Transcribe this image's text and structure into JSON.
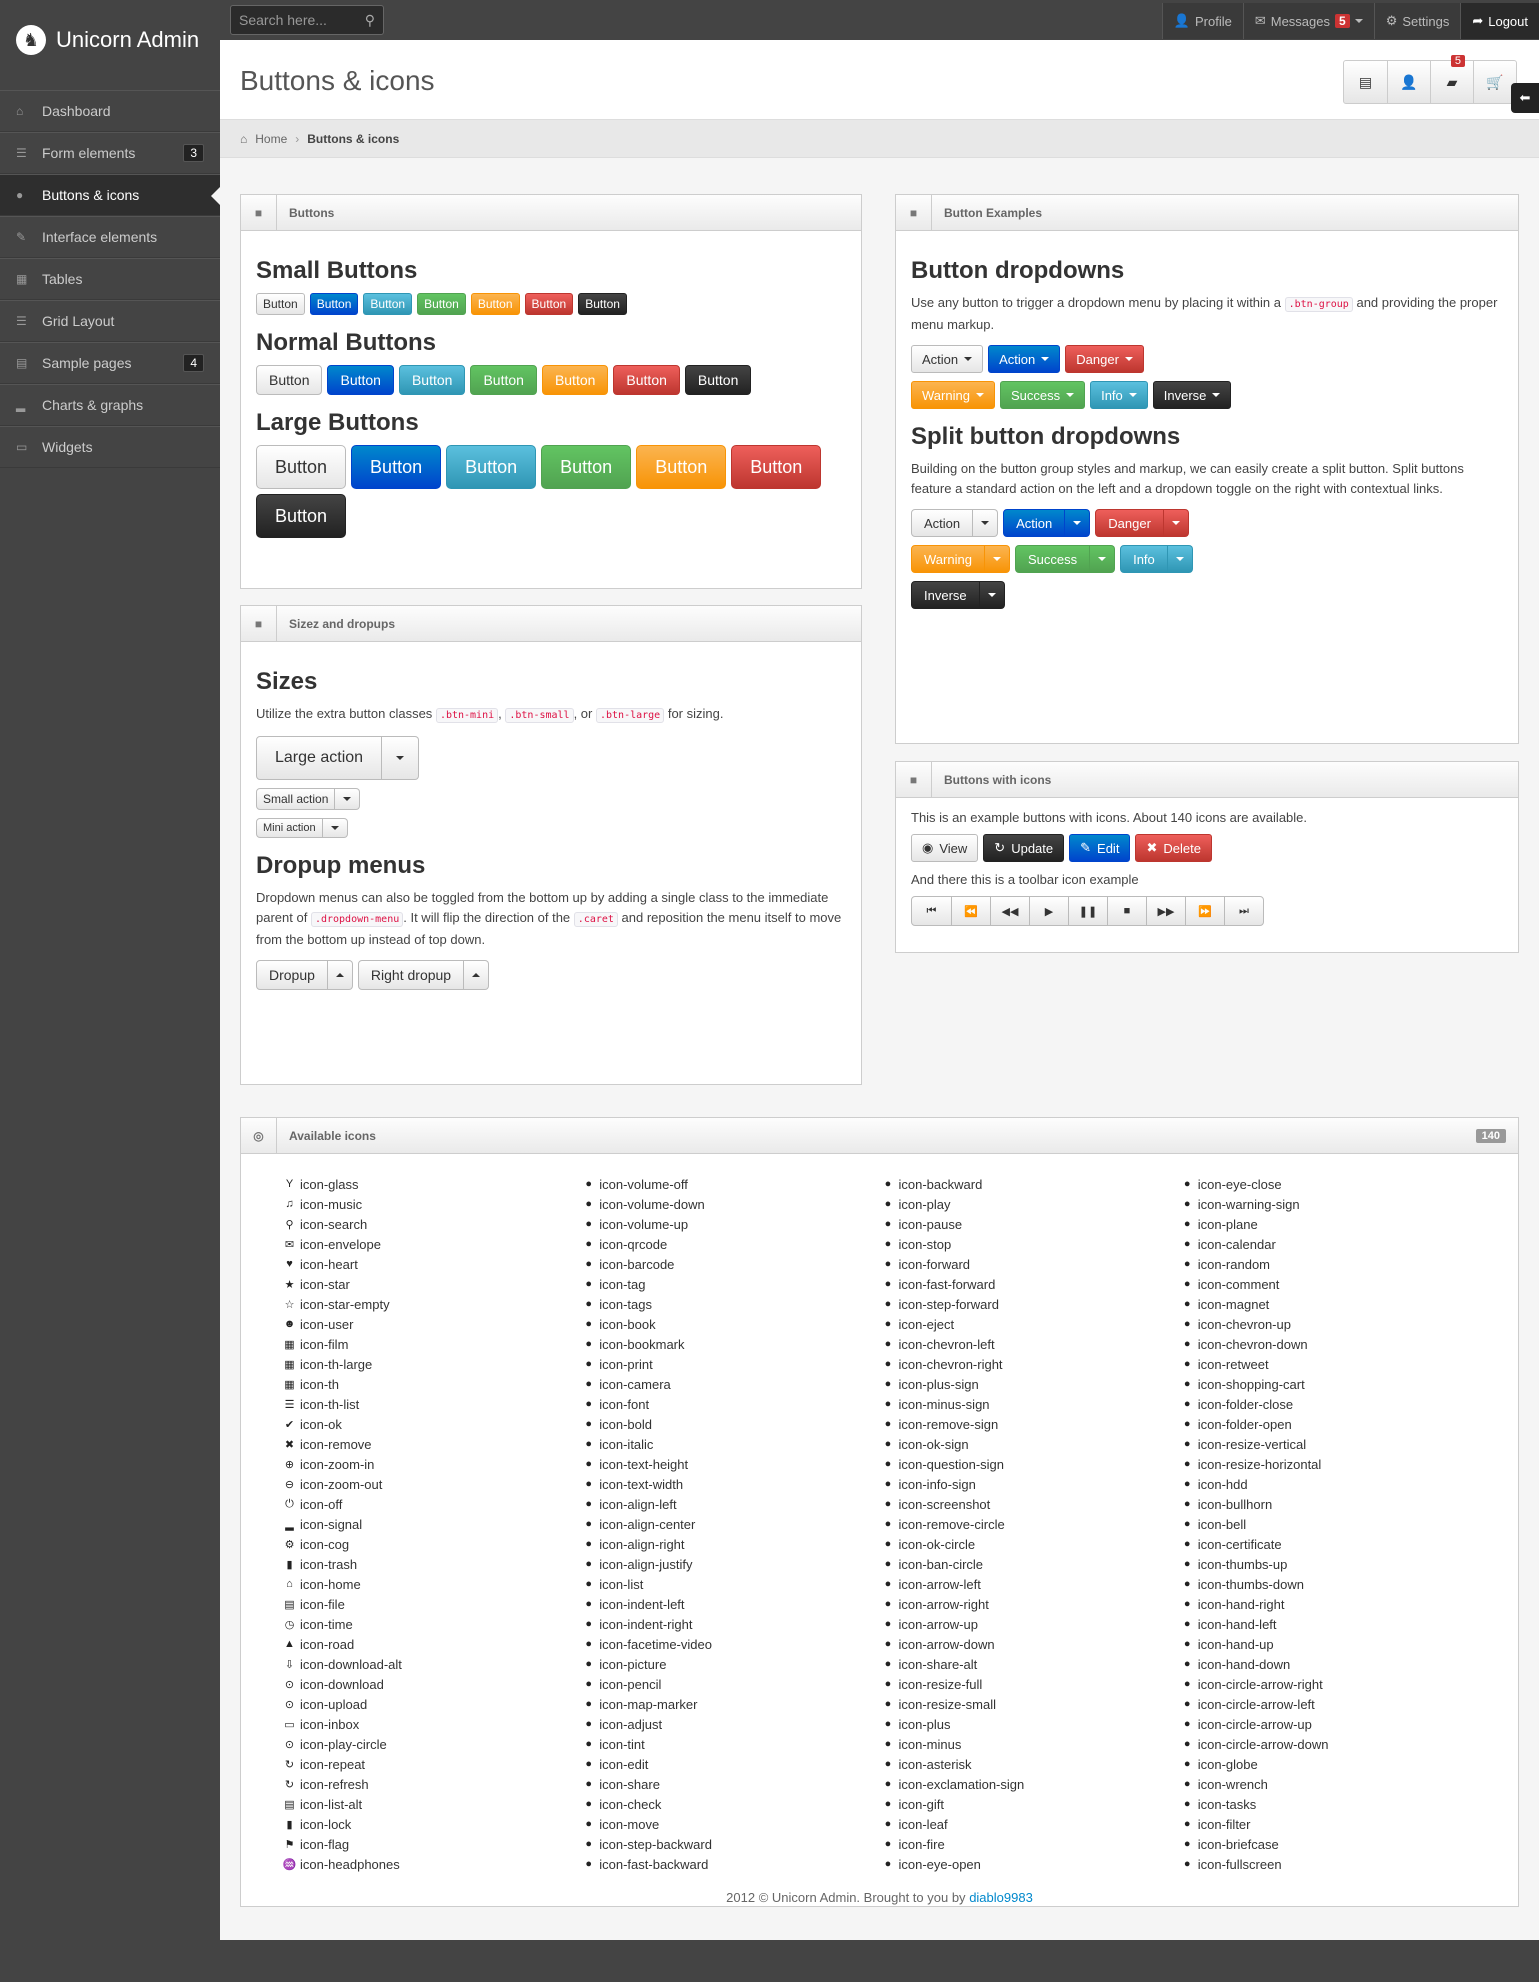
{
  "app": {
    "brand": "Unicorn Admin"
  },
  "search": {
    "placeholder": "Search here..."
  },
  "topnav": {
    "profile": "Profile",
    "messages": "Messages",
    "messages_count": "5",
    "settings": "Settings",
    "logout": "Logout"
  },
  "sidebar": {
    "items": [
      {
        "label": "Dashboard",
        "count": ""
      },
      {
        "label": "Form elements",
        "count": "3"
      },
      {
        "label": "Buttons & icons",
        "count": ""
      },
      {
        "label": "Interface elements",
        "count": ""
      },
      {
        "label": "Tables",
        "count": ""
      },
      {
        "label": "Grid Layout",
        "count": ""
      },
      {
        "label": "Sample pages",
        "count": "4"
      },
      {
        "label": "Charts & graphs",
        "count": ""
      },
      {
        "label": "Widgets",
        "count": ""
      }
    ]
  },
  "page": {
    "title": "Buttons & icons",
    "cart_badge": "5"
  },
  "breadcrumb": {
    "home": "Home",
    "current": "Buttons & icons"
  },
  "buttons_widget": {
    "title": "Buttons",
    "small_heading": "Small Buttons",
    "normal_heading": "Normal Buttons",
    "large_heading": "Large Buttons",
    "button_label": "Button"
  },
  "sizes_widget": {
    "title": "Sizez and dropups",
    "sizes_heading": "Sizes",
    "sizes_text_1": "Utilize the extra button classes",
    "code_mini": ".btn-mini",
    "code_small": ".btn-small",
    "sizes_text_or": ", or",
    "code_large": ".btn-large",
    "sizes_text_2": "for sizing.",
    "large_action": "Large action",
    "small_action": "Small action",
    "mini_action": "Mini action",
    "dropup_heading": "Dropup menus",
    "dropup_text_1": "Dropdown menus can also be toggled from the bottom up by adding a single class to the immediate parent of",
    "code_dropdown_menu": ".dropdown-menu",
    "dropup_text_2": ". It will flip the direction of the",
    "code_caret": ".caret",
    "dropup_text_3": "and reposition the menu itself to move from the bottom up instead of top down.",
    "dropup": "Dropup",
    "right_dropup": "Right dropup"
  },
  "examples_widget": {
    "title": "Button Examples",
    "dropdowns_heading": "Button dropdowns",
    "dropdowns_text_1": "Use any button to trigger a dropdown menu by placing it within a",
    "code_btn_group": ".btn-group",
    "dropdowns_text_2": "and providing the proper menu markup.",
    "split_heading": "Split button dropdowns",
    "split_text": "Building on the button group styles and markup, we can easily create a split button. Split buttons feature a standard action on the left and a dropdown toggle on the right with contextual links.",
    "labels": {
      "action": "Action",
      "danger": "Danger",
      "warning": "Warning",
      "success": "Success",
      "info": "Info",
      "inverse": "Inverse"
    }
  },
  "icons_widget": {
    "title": "Buttons with icons",
    "text": "This is an example buttons with icons. About 140 icons are available.",
    "view": "View",
    "update": "Update",
    "edit": "Edit",
    "delete": "Delete",
    "toolbar_text": "And there this is a toolbar icon example"
  },
  "available_icons": {
    "title": "Available icons",
    "count": "140",
    "columns": [
      [
        "icon-glass",
        "icon-music",
        "icon-search",
        "icon-envelope",
        "icon-heart",
        "icon-star",
        "icon-star-empty",
        "icon-user",
        "icon-film",
        "icon-th-large",
        "icon-th",
        "icon-th-list",
        "icon-ok",
        "icon-remove",
        "icon-zoom-in",
        "icon-zoom-out",
        "icon-off",
        "icon-signal",
        "icon-cog",
        "icon-trash",
        "icon-home",
        "icon-file",
        "icon-time",
        "icon-road",
        "icon-download-alt",
        "icon-download",
        "icon-upload",
        "icon-inbox",
        "icon-play-circle",
        "icon-repeat",
        "icon-refresh",
        "icon-list-alt",
        "icon-lock",
        "icon-flag",
        "icon-headphones"
      ],
      [
        "icon-volume-off",
        "icon-volume-down",
        "icon-volume-up",
        "icon-qrcode",
        "icon-barcode",
        "icon-tag",
        "icon-tags",
        "icon-book",
        "icon-bookmark",
        "icon-print",
        "icon-camera",
        "icon-font",
        "icon-bold",
        "icon-italic",
        "icon-text-height",
        "icon-text-width",
        "icon-align-left",
        "icon-align-center",
        "icon-align-right",
        "icon-align-justify",
        "icon-list",
        "icon-indent-left",
        "icon-indent-right",
        "icon-facetime-video",
        "icon-picture",
        "icon-pencil",
        "icon-map-marker",
        "icon-adjust",
        "icon-tint",
        "icon-edit",
        "icon-share",
        "icon-check",
        "icon-move",
        "icon-step-backward",
        "icon-fast-backward"
      ],
      [
        "icon-backward",
        "icon-play",
        "icon-pause",
        "icon-stop",
        "icon-forward",
        "icon-fast-forward",
        "icon-step-forward",
        "icon-eject",
        "icon-chevron-left",
        "icon-chevron-right",
        "icon-plus-sign",
        "icon-minus-sign",
        "icon-remove-sign",
        "icon-ok-sign",
        "icon-question-sign",
        "icon-info-sign",
        "icon-screenshot",
        "icon-remove-circle",
        "icon-ok-circle",
        "icon-ban-circle",
        "icon-arrow-left",
        "icon-arrow-right",
        "icon-arrow-up",
        "icon-arrow-down",
        "icon-share-alt",
        "icon-resize-full",
        "icon-resize-small",
        "icon-plus",
        "icon-minus",
        "icon-asterisk",
        "icon-exclamation-sign",
        "icon-gift",
        "icon-leaf",
        "icon-fire",
        "icon-eye-open"
      ],
      [
        "icon-eye-close",
        "icon-warning-sign",
        "icon-plane",
        "icon-calendar",
        "icon-random",
        "icon-comment",
        "icon-magnet",
        "icon-chevron-up",
        "icon-chevron-down",
        "icon-retweet",
        "icon-shopping-cart",
        "icon-folder-close",
        "icon-folder-open",
        "icon-resize-vertical",
        "icon-resize-horizontal",
        "icon-hdd",
        "icon-bullhorn",
        "icon-bell",
        "icon-certificate",
        "icon-thumbs-up",
        "icon-thumbs-down",
        "icon-hand-right",
        "icon-hand-left",
        "icon-hand-up",
        "icon-hand-down",
        "icon-circle-arrow-right",
        "icon-circle-arrow-left",
        "icon-circle-arrow-up",
        "icon-circle-arrow-down",
        "icon-globe",
        "icon-wrench",
        "icon-tasks",
        "icon-filter",
        "icon-briefcase",
        "icon-fullscreen"
      ]
    ]
  },
  "footer": {
    "text": "2012 © Unicorn Admin. Brought to you by",
    "link": "diablo9983"
  }
}
